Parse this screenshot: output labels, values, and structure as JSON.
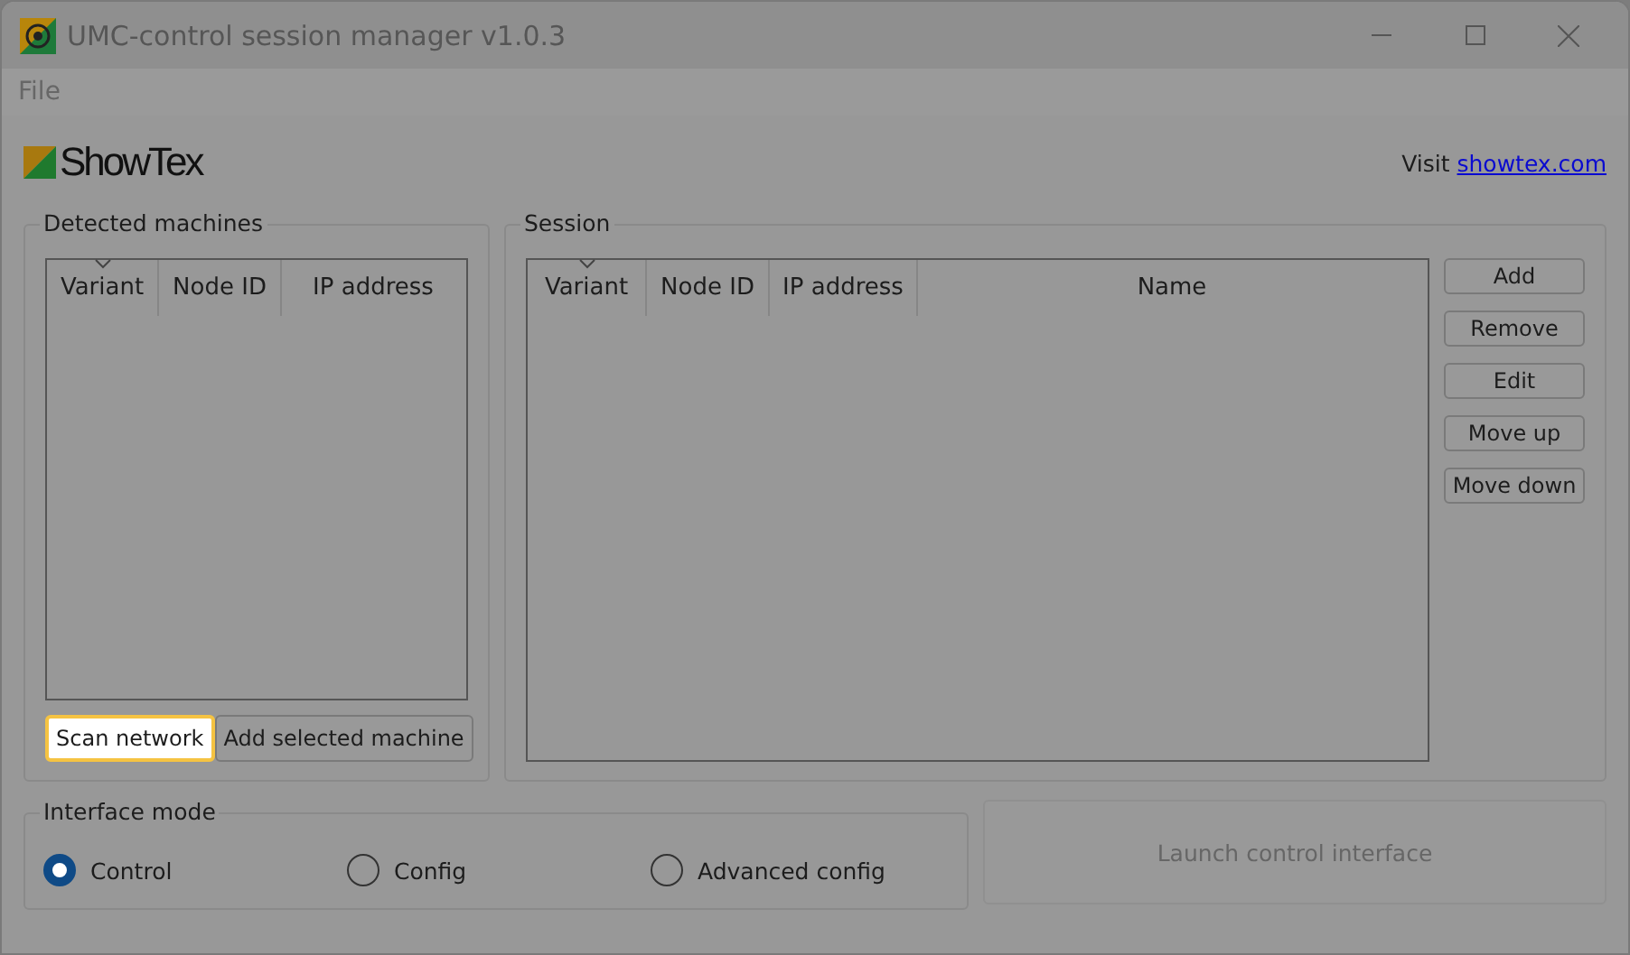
{
  "window": {
    "title": "UMC-control session manager v1.0.3"
  },
  "menu": [
    "File"
  ],
  "header": {
    "logo": "ShowTex",
    "visit_label": "Visit",
    "link": "showtex.com"
  },
  "detected": {
    "title": "Detected machines",
    "columns": [
      {
        "label": "Variant",
        "sorted": true
      },
      {
        "label": "Node ID",
        "sorted": false
      },
      {
        "label": "IP address",
        "sorted": false
      }
    ],
    "buttons": [
      {
        "label": "Scan network",
        "focused": true
      },
      {
        "label": "Add selected machine",
        "focused": false
      }
    ]
  },
  "session": {
    "title": "Session",
    "columns": [
      {
        "label": "Variant",
        "sorted": true
      },
      {
        "label": "Node ID",
        "sorted": false
      },
      {
        "label": "IP address",
        "sorted": false
      },
      {
        "label": "Name",
        "sorted": false
      }
    ],
    "buttons": [
      "Add",
      "Remove",
      "Edit",
      "Move up",
      "Move down"
    ]
  },
  "interface_mode": {
    "title": "Interface mode",
    "options": [
      {
        "label": "Control",
        "selected": true
      },
      {
        "label": "Config",
        "selected": false
      },
      {
        "label": "Advanced config",
        "selected": false
      }
    ]
  },
  "launch": {
    "label": "Launch control interface",
    "disabled": true
  }
}
